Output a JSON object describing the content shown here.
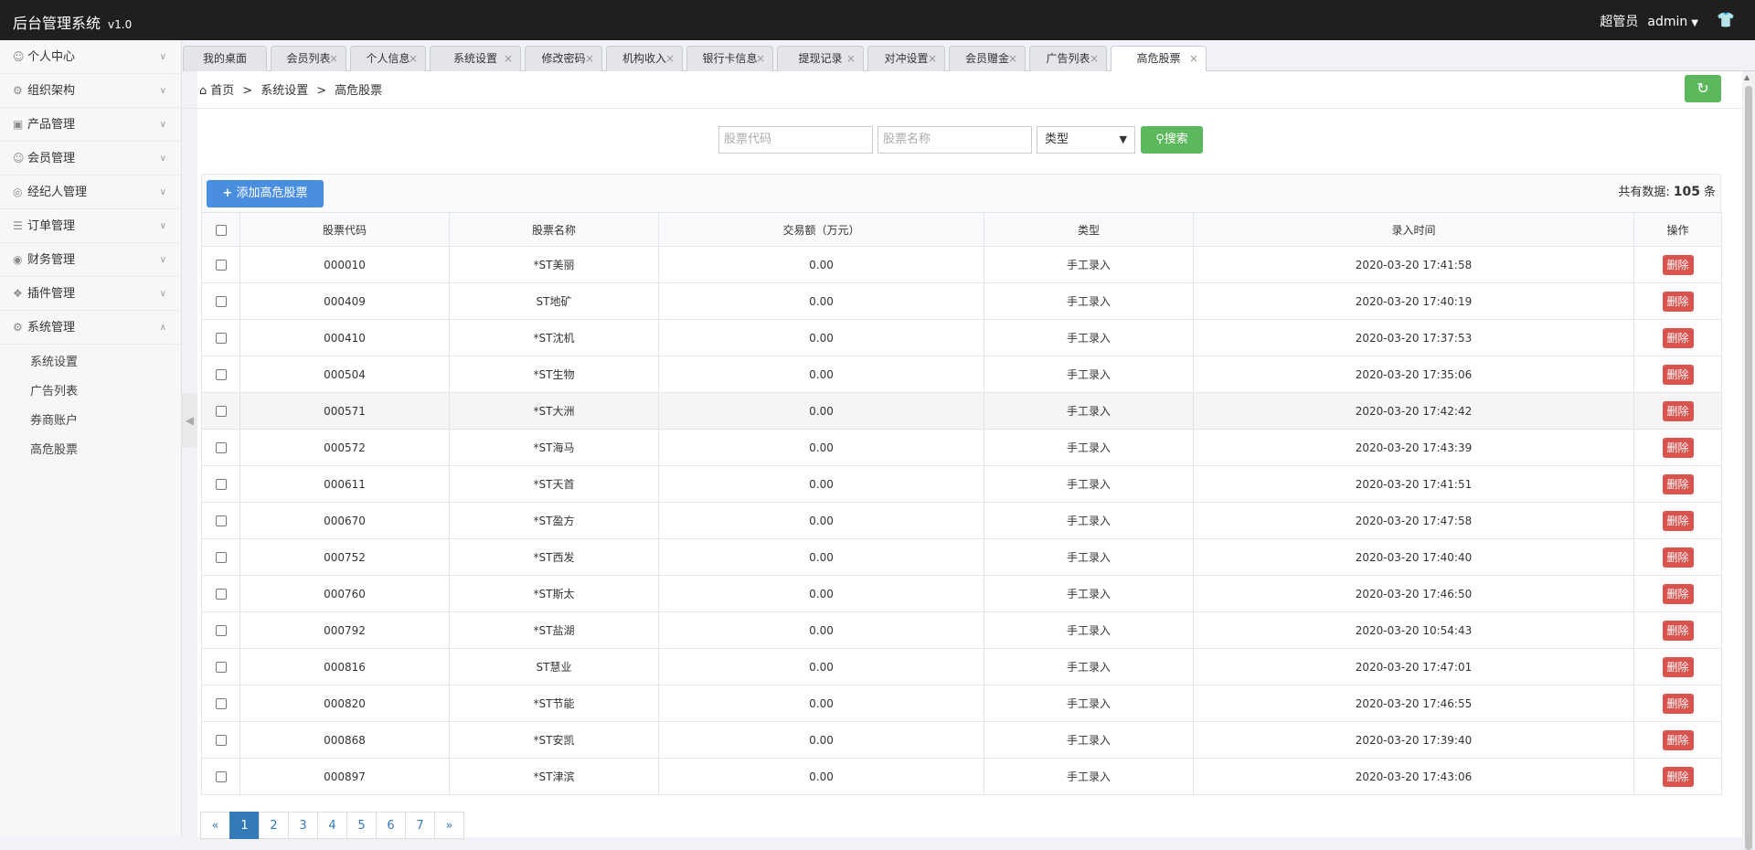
{
  "app": {
    "title": "后台管理系统",
    "version": "v1.0",
    "role": "超管员",
    "username": "admin"
  },
  "sidebar": {
    "items": [
      {
        "label": "个人中心",
        "icon": "user-icon"
      },
      {
        "label": "组织架构",
        "icon": "org-icon"
      },
      {
        "label": "产品管理",
        "icon": "briefcase-icon"
      },
      {
        "label": "会员管理",
        "icon": "member-icon"
      },
      {
        "label": "经纪人管理",
        "icon": "broker-icon"
      },
      {
        "label": "订单管理",
        "icon": "order-icon"
      },
      {
        "label": "财务管理",
        "icon": "finance-icon"
      },
      {
        "label": "插件管理",
        "icon": "plugin-icon"
      },
      {
        "label": "系统管理",
        "icon": "gear-icon"
      }
    ],
    "submenu": [
      "系统设置",
      "广告列表",
      "券商账户",
      "高危股票"
    ]
  },
  "tabs": [
    "我的桌面",
    "会员列表",
    "个人信息",
    "系统设置",
    "修改密码",
    "机构收入",
    "银行卡信息",
    "提现记录",
    "对冲设置",
    "会员赠金",
    "广告列表",
    "高危股票"
  ],
  "breadcrumb": {
    "home": "首页",
    "parent": "系统设置",
    "current": "高危股票"
  },
  "filters": {
    "code_placeholder": "股票代码",
    "name_placeholder": "股票名称",
    "type_label": "类型",
    "search_label": "搜索"
  },
  "toolbar": {
    "add_label": "添加高危股票",
    "total_prefix": "共有数据:",
    "total_count": "105",
    "total_suffix": "条"
  },
  "table": {
    "headers": [
      "股票代码",
      "股票名称",
      "交易额（万元）",
      "类型",
      "录入时间",
      "操作"
    ],
    "delete_label": "删除",
    "rows": [
      {
        "code": "000010",
        "name": "*ST美丽",
        "amount": "0.00",
        "type": "手工录入",
        "time": "2020-03-20 17:41:58"
      },
      {
        "code": "000409",
        "name": "ST地矿",
        "amount": "0.00",
        "type": "手工录入",
        "time": "2020-03-20 17:40:19"
      },
      {
        "code": "000410",
        "name": "*ST沈机",
        "amount": "0.00",
        "type": "手工录入",
        "time": "2020-03-20 17:37:53"
      },
      {
        "code": "000504",
        "name": "*ST生物",
        "amount": "0.00",
        "type": "手工录入",
        "time": "2020-03-20 17:35:06"
      },
      {
        "code": "000571",
        "name": "*ST大洲",
        "amount": "0.00",
        "type": "手工录入",
        "time": "2020-03-20 17:42:42"
      },
      {
        "code": "000572",
        "name": "*ST海马",
        "amount": "0.00",
        "type": "手工录入",
        "time": "2020-03-20 17:43:39"
      },
      {
        "code": "000611",
        "name": "*ST天首",
        "amount": "0.00",
        "type": "手工录入",
        "time": "2020-03-20 17:41:51"
      },
      {
        "code": "000670",
        "name": "*ST盈方",
        "amount": "0.00",
        "type": "手工录入",
        "time": "2020-03-20 17:47:58"
      },
      {
        "code": "000752",
        "name": "*ST西发",
        "amount": "0.00",
        "type": "手工录入",
        "time": "2020-03-20 17:40:40"
      },
      {
        "code": "000760",
        "name": "*ST斯太",
        "amount": "0.00",
        "type": "手工录入",
        "time": "2020-03-20 17:46:50"
      },
      {
        "code": "000792",
        "name": "*ST盐湖",
        "amount": "0.00",
        "type": "手工录入",
        "time": "2020-03-20 10:54:43"
      },
      {
        "code": "000816",
        "name": "ST慧业",
        "amount": "0.00",
        "type": "手工录入",
        "time": "2020-03-20 17:47:01"
      },
      {
        "code": "000820",
        "name": "*ST节能",
        "amount": "0.00",
        "type": "手工录入",
        "time": "2020-03-20 17:46:55"
      },
      {
        "code": "000868",
        "name": "*ST安凯",
        "amount": "0.00",
        "type": "手工录入",
        "time": "2020-03-20 17:39:40"
      },
      {
        "code": "000897",
        "name": "*ST津滨",
        "amount": "0.00",
        "type": "手工录入",
        "time": "2020-03-20 17:43:06"
      }
    ]
  },
  "pagination": {
    "prev": "«",
    "pages": [
      "1",
      "2",
      "3",
      "4",
      "5",
      "6",
      "7"
    ],
    "next": "»",
    "current": "1"
  },
  "colors": {
    "topbar": "#1f1f1f",
    "success": "#5cb85c",
    "primary": "#4a8fdf",
    "danger": "#d9534f",
    "link": "#337ab7"
  }
}
